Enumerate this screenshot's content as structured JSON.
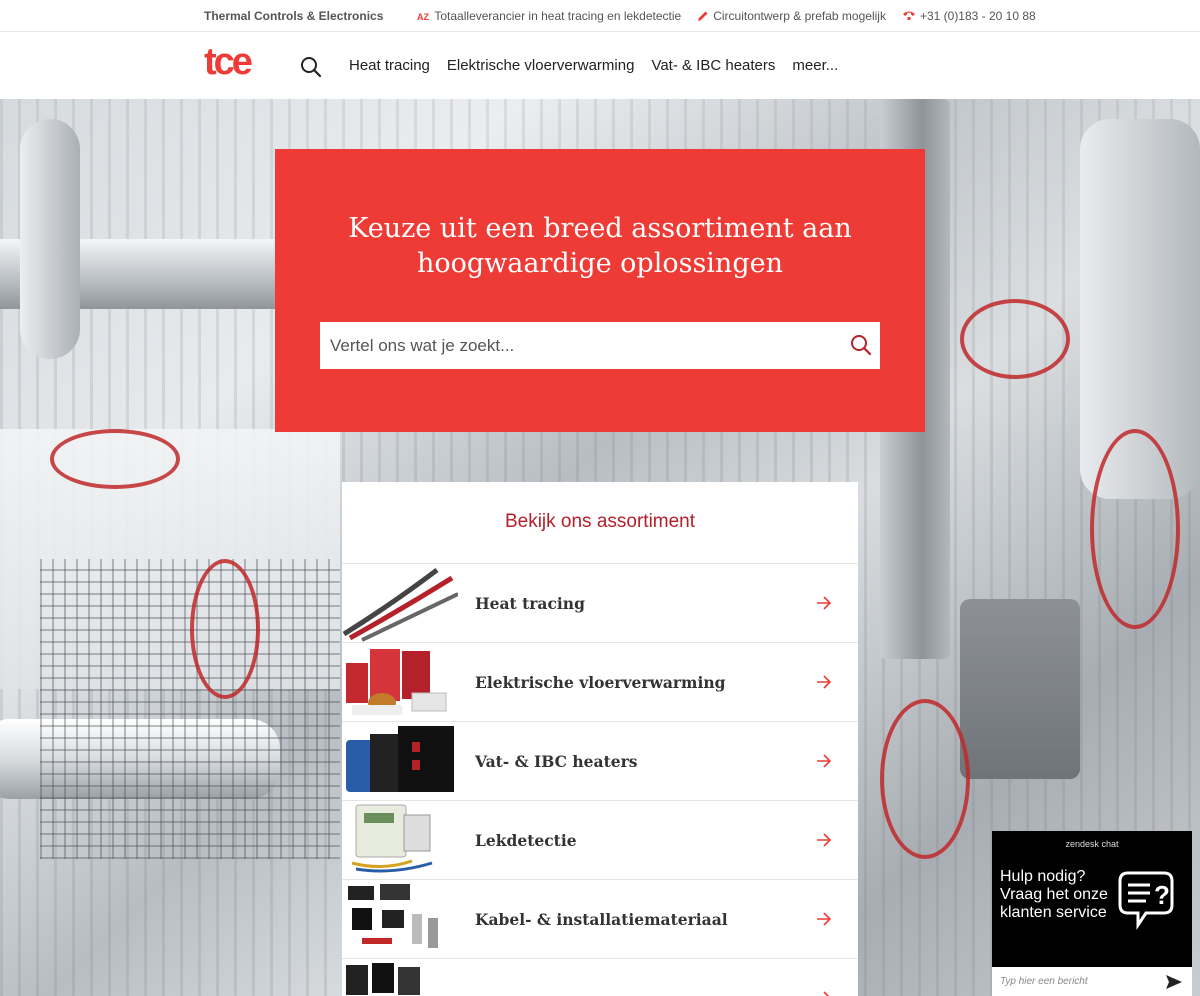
{
  "topbar": {
    "brand": "Thermal Controls & Electronics",
    "usps": [
      {
        "icon": "az-icon",
        "text": "Totaalleverancier in heat tracing en lekdetectie"
      },
      {
        "icon": "pencil-icon",
        "text": "Circuitontwerp & prefab mogelijk"
      },
      {
        "icon": "phone-icon",
        "text": "+31 (0)183 - 20 10 88"
      }
    ]
  },
  "header": {
    "logo_text": "tce",
    "nav": [
      "Heat tracing",
      "Elektrische vloerverwarming",
      "Vat- & IBC heaters",
      "meer..."
    ]
  },
  "hero": {
    "title_line1": "Keuze uit een breed assortiment aan",
    "title_line2": "hoogwaardige oplossingen",
    "search_placeholder": "Vertel ons wat je zoekt..."
  },
  "assortment": {
    "title": "Bekijk ons assortiment",
    "items": [
      {
        "label": "Heat tracing"
      },
      {
        "label": "Elektrische vloerverwarming"
      },
      {
        "label": "Vat- & IBC heaters"
      },
      {
        "label": "Lekdetectie"
      },
      {
        "label": "Kabel- & installatiemateriaal"
      }
    ]
  },
  "chat": {
    "header": "zendesk chat",
    "message": "Hulp nodig? Vraag het onze klanten service",
    "input_placeholder": "Typ hier een bericht"
  },
  "colors": {
    "accent": "#ee3b35",
    "panel_title": "#b5212a",
    "chat_bg": "#000000"
  }
}
